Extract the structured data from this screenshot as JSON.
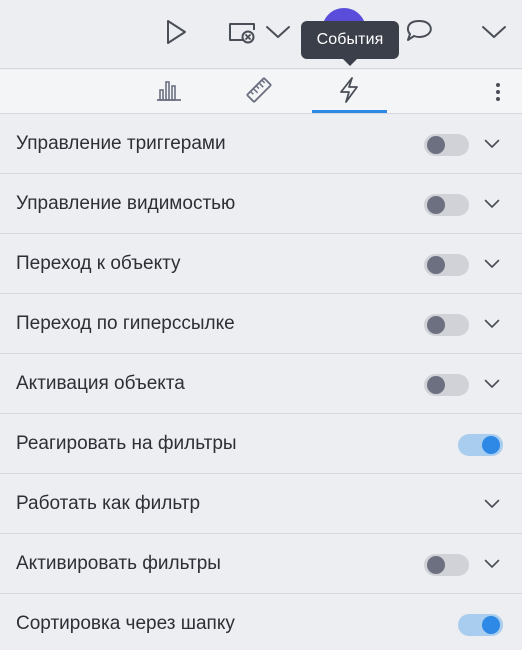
{
  "tooltip": {
    "text": "События"
  },
  "tabs": [
    {
      "id": "chart",
      "icon": "bar-chart-icon",
      "active": false
    },
    {
      "id": "ruler",
      "icon": "ruler-icon",
      "active": false
    },
    {
      "id": "events",
      "icon": "lightning-icon",
      "active": true
    }
  ],
  "colors": {
    "accent": "#2e88e5",
    "toggle_on_track": "#a9cdee",
    "toggle_off_track": "#d0d2d7"
  },
  "rows": [
    {
      "label": "Управление триггерами",
      "toggle": "off",
      "expand": true
    },
    {
      "label": "Управление видимостью",
      "toggle": "off",
      "expand": true
    },
    {
      "label": "Переход к объекту",
      "toggle": "off",
      "expand": true
    },
    {
      "label": "Переход по гиперссылке",
      "toggle": "off",
      "expand": true
    },
    {
      "label": "Активация объекта",
      "toggle": "off",
      "expand": true
    },
    {
      "label": "Реагировать на фильтры",
      "toggle": "on",
      "expand": false
    },
    {
      "label": "Работать как фильтр",
      "toggle": "none",
      "expand": true
    },
    {
      "label": "Активировать фильтры",
      "toggle": "off",
      "expand": true
    },
    {
      "label": "Сортировка через шапку",
      "toggle": "on",
      "expand": false
    }
  ]
}
